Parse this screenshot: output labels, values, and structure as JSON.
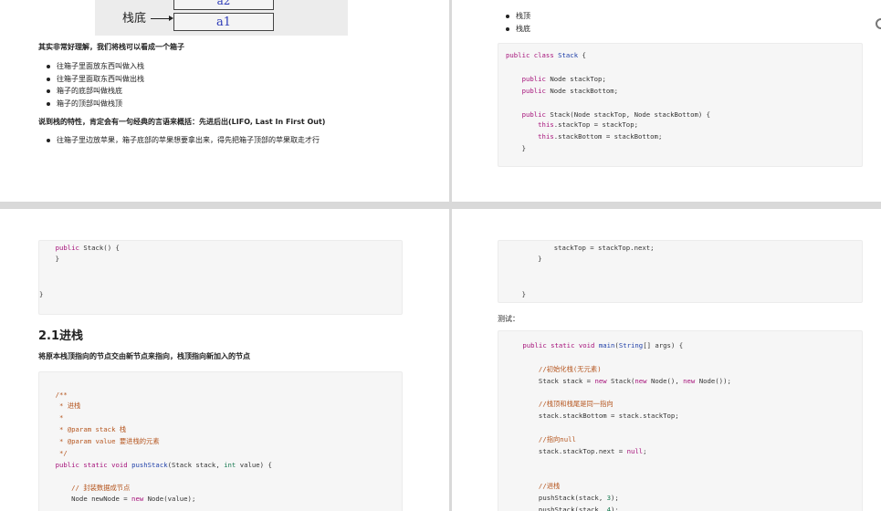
{
  "page1": {
    "figure": {
      "top_cell": "a2",
      "bottom_cell": "a1",
      "label": "栈底"
    },
    "intro": "其实非常好理解，我们将栈可以看成一个箱子",
    "bullets": [
      "往箱子里面放东西叫做入栈",
      "往箱子里面取东西叫做出栈",
      "箱子的底部叫做栈底",
      "箱子的顶部叫做栈顶"
    ],
    "property": "说到栈的特性，肯定会有一句经典的言语来概括：先进后出(LIFO, Last In First Out)",
    "example": "往箱子里边放苹果，箱子底部的苹果想要拿出来，得先把箱子顶部的苹果取走才行"
  },
  "page2": {
    "bullets": [
      "栈顶",
      "栈底"
    ],
    "code": [
      "public class Stack {",
      "",
      "    public Node stackTop;",
      "    public Node stackBottom;",
      "",
      "    public Stack(Node stackTop, Node stackBottom) {",
      "        this.stackTop = stackTop;",
      "        this.stackBottom = stackBottom;",
      "    }"
    ]
  },
  "page3": {
    "code_top": [
      "    public Stack() {",
      "    }",
      "",
      "",
      "}"
    ],
    "heading": "2.1进栈",
    "desc": "将原本栈顶指向的节点交由新节点来指向，栈顶指向新加入的节点",
    "code": [
      "    /**",
      "     * 进栈",
      "     *",
      "     * @param stack 栈",
      "     * @param value 要进栈的元素",
      "     */",
      "    public static void pushStack(Stack stack, int value) {",
      "",
      "        // 封装数据成节点",
      "        Node newNode = new Node(value);"
    ]
  },
  "page4": {
    "code_top": [
      "            stackTop = stackTop.next;",
      "        }",
      "",
      "",
      "    }"
    ],
    "test_label": "测试：",
    "code": [
      "    public static void main(String[] args) {",
      "",
      "        //初始化栈(无元素)",
      "        Stack stack = new Stack(new Node(), new Node());",
      "",
      "        //栈顶和栈尾是同一指向",
      "        stack.stackBottom = stack.stackTop;",
      "",
      "        //指向null",
      "        stack.stackTop.next = null;",
      "",
      "",
      "        //进栈",
      "        pushStack(stack, 3);",
      "        pushStack(stack, 4);"
    ]
  }
}
